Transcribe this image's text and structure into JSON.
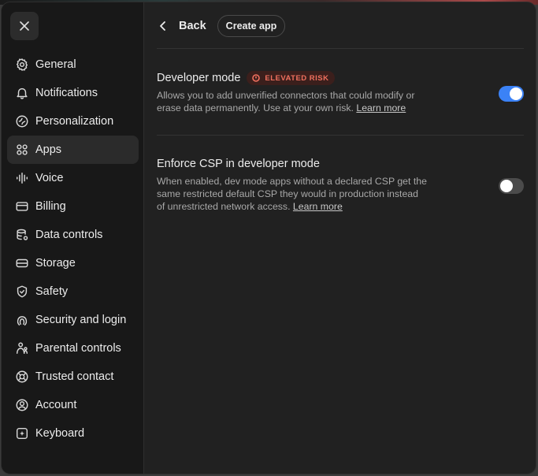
{
  "sidebar": {
    "close_icon": "close-icon",
    "items": [
      {
        "label": "General",
        "icon": "gear-icon"
      },
      {
        "label": "Notifications",
        "icon": "bell-icon"
      },
      {
        "label": "Personalization",
        "icon": "personalization-icon"
      },
      {
        "label": "Apps",
        "icon": "apps-icon",
        "active": true
      },
      {
        "label": "Voice",
        "icon": "waveform-icon"
      },
      {
        "label": "Billing",
        "icon": "card-icon"
      },
      {
        "label": "Data controls",
        "icon": "database-icon"
      },
      {
        "label": "Storage",
        "icon": "storage-icon"
      },
      {
        "label": "Safety",
        "icon": "shield-icon"
      },
      {
        "label": "Security and login",
        "icon": "security-icon"
      },
      {
        "label": "Parental controls",
        "icon": "parental-icon"
      },
      {
        "label": "Trusted contact",
        "icon": "lifebuoy-icon"
      },
      {
        "label": "Account",
        "icon": "account-icon"
      },
      {
        "label": "Keyboard",
        "icon": "keyboard-icon"
      }
    ]
  },
  "header": {
    "back_label": "Back",
    "create_app_label": "Create app"
  },
  "settings": {
    "developer_mode": {
      "title": "Developer mode",
      "badge": "ELEVATED RISK",
      "description": "Allows you to add unverified connectors that could modify or erase data permanently. Use at your own risk.",
      "link": "Learn more",
      "enabled": true
    },
    "enforce_csp": {
      "title": "Enforce CSP in developer mode",
      "description": "When enabled, dev mode apps without a declared CSP get the same restricted default CSP they would in production instead of unrestricted network access.",
      "link": "Learn more",
      "enabled": false
    }
  },
  "colors": {
    "accent": "#3b82f6",
    "badge_text": "#f0705e",
    "badge_bg": "#3b1f1c"
  }
}
